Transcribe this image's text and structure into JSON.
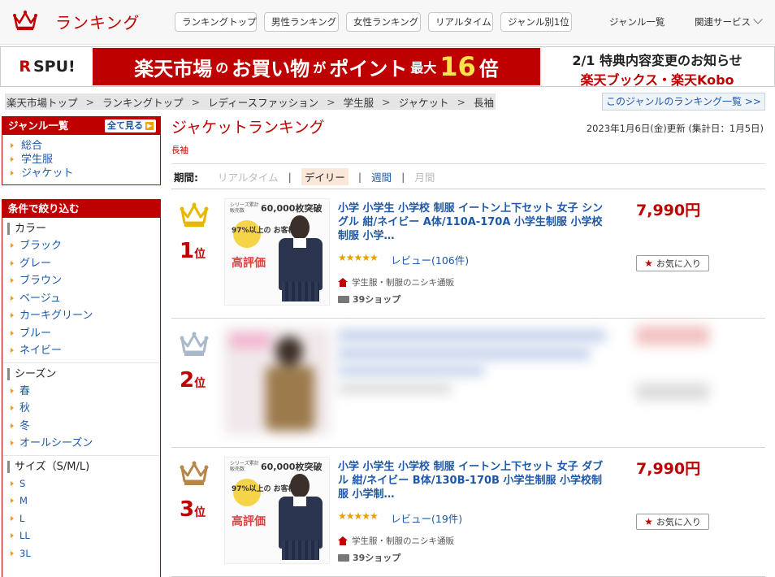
{
  "header": {
    "brand": "ランキング",
    "nav": [
      "ランキングトップ",
      "男性ランキング",
      "女性ランキング",
      "リアルタイム",
      "ジャンル別1位"
    ],
    "genre_list": "ジャンル一覧",
    "related_services": "関連サービス"
  },
  "banner": {
    "spu_r": "R",
    "spu": "SPU!",
    "main_part1": "楽天市場",
    "main_part2": "の",
    "main_part3": "お買い物",
    "main_part4": "が",
    "main_part5": "ポイント",
    "main_part6": "最大",
    "main_num": "16",
    "main_part7": "倍",
    "right_line1": "2/1 特典内容変更のお知らせ",
    "right_line2": "楽天ブックス・楽天Kobo"
  },
  "breadcrumb": [
    "楽天市場トップ",
    "ランキングトップ",
    "レディースファッション",
    "学生服",
    "ジャケット",
    "長袖"
  ],
  "breadcrumb_sep": ">",
  "genre_ranking_link": "このジャンルのランキング一覧 >>",
  "sidebar": {
    "genre_title": "ジャンル一覧",
    "see_all": "全て見る",
    "genres": [
      "総合",
      "学生服",
      "ジャケット"
    ],
    "filter_title": "条件で絞り込む",
    "color_title": "カラー",
    "colors": [
      "ブラック",
      "グレー",
      "ブラウン",
      "ベージュ",
      "カーキグリーン",
      "ブルー",
      "ネイビー"
    ],
    "season_title": "シーズン",
    "seasons": [
      "春",
      "秋",
      "冬",
      "オールシーズン"
    ],
    "size_title": "サイズ（S/M/L)",
    "sizes": [
      "S",
      "M",
      "L",
      "LL",
      "3L"
    ]
  },
  "main": {
    "title": "ジャケットランキング",
    "subtitle": "長袖",
    "updated": "2023年1月6日(金)更新 (集計日：1月5日)",
    "period_label": "期間:",
    "periods": [
      "リアルタイム",
      "デイリー",
      "週間",
      "月間"
    ],
    "period_sep": "|"
  },
  "items": [
    {
      "rank": "1",
      "rank_suffix": "位",
      "crown_color": "#e8b800",
      "thumb_series": "シリーズ累計販売数",
      "thumb_count": "60,000枚突破",
      "thumb_pct": "97%以上の お客様から",
      "thumb_rating": "高評価",
      "title": "小学 小学生 小学校 制服 イートン上下セット 女子 シングル 紺/ネイビー A体/110A-170A 小学生制服 小学校制服 小学…",
      "stars": "★★★★★",
      "review": "レビュー(106件)",
      "shop": "学生服・制服のニシキ通販",
      "ship": "39ショップ",
      "price": "7,990円",
      "fav": "お気に入り"
    },
    {
      "rank": "2",
      "rank_suffix": "位",
      "crown_color": "#a9b9c9"
    },
    {
      "rank": "3",
      "rank_suffix": "位",
      "crown_color": "#b8864b",
      "thumb_series": "シリーズ累計販売数",
      "thumb_count": "60,000枚突破",
      "thumb_pct": "97%以上の お客様から",
      "thumb_rating": "高評価",
      "title": "小学 小学生 小学校 制服 イートン上下セット 女子 ダブル 紺/ネイビー B体/130B-170B 小学生制服 小学校制服 小学制…",
      "stars": "★★★★★",
      "review": "レビュー(19件)",
      "shop": "学生服・制服のニシキ通販",
      "ship": "39ショップ",
      "price": "7,990円",
      "fav": "お気に入り"
    }
  ]
}
